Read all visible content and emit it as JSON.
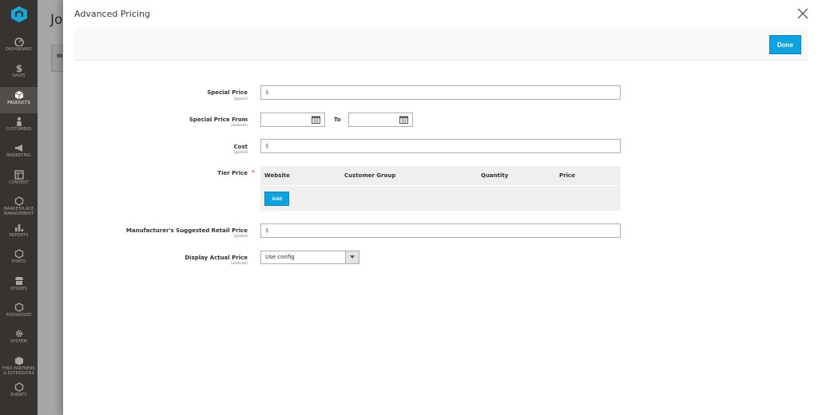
{
  "sidebar": {
    "items": [
      {
        "label": "DASHBOARD",
        "icon": "dashboard-icon"
      },
      {
        "label": "SALES",
        "icon": "dollar-icon"
      },
      {
        "label": "PRODUCTS",
        "icon": "cube-icon",
        "active": true
      },
      {
        "label": "CUSTOMERS",
        "icon": "person-icon"
      },
      {
        "label": "MARKETING",
        "icon": "megaphone-icon"
      },
      {
        "label": "CONTENT",
        "icon": "layout-icon"
      },
      {
        "label": "MARKETPLACE\nMANAGEMENT",
        "icon": "hexagon-icon"
      },
      {
        "label": "REPORTS",
        "icon": "bar-chart-icon"
      },
      {
        "label": "PORTO",
        "icon": "hexagon-icon"
      },
      {
        "label": "STORES",
        "icon": "store-icon"
      },
      {
        "label": "PUSHASSIST",
        "icon": "hexagon-icon"
      },
      {
        "label": "SYSTEM",
        "icon": "gear-icon"
      },
      {
        "label": "FIND PARTNERS\n& EXTENSIONS",
        "icon": "box-icon"
      },
      {
        "label": "EVENTS",
        "icon": "hexagon-icon"
      }
    ]
  },
  "background": {
    "title": "Jou",
    "box_label": "St"
  },
  "modal": {
    "title": "Advanced Pricing",
    "done_label": "Done"
  },
  "form": {
    "special_price": {
      "label": "Special Price",
      "scope": "[global]",
      "prefix": "$"
    },
    "special_price_from": {
      "label": "Special Price From",
      "scope": "[website]",
      "to_label": "To"
    },
    "cost": {
      "label": "Cost",
      "scope": "[global]",
      "prefix": "$"
    },
    "tier_price": {
      "label": "Tier Price",
      "columns": [
        "Website",
        "Customer Group",
        "Quantity",
        "Price"
      ],
      "add_label": "Add"
    },
    "msrp": {
      "label": "Manufacturer's Suggested Retail Price",
      "scope": "[global]",
      "prefix": "$"
    },
    "display_actual_price": {
      "label": "Display Actual Price",
      "scope": "[website]",
      "value": "Use config"
    }
  },
  "colors": {
    "sidebar_bg": "#373330",
    "accent": "#0ea2e0",
    "required": "#e22626"
  }
}
